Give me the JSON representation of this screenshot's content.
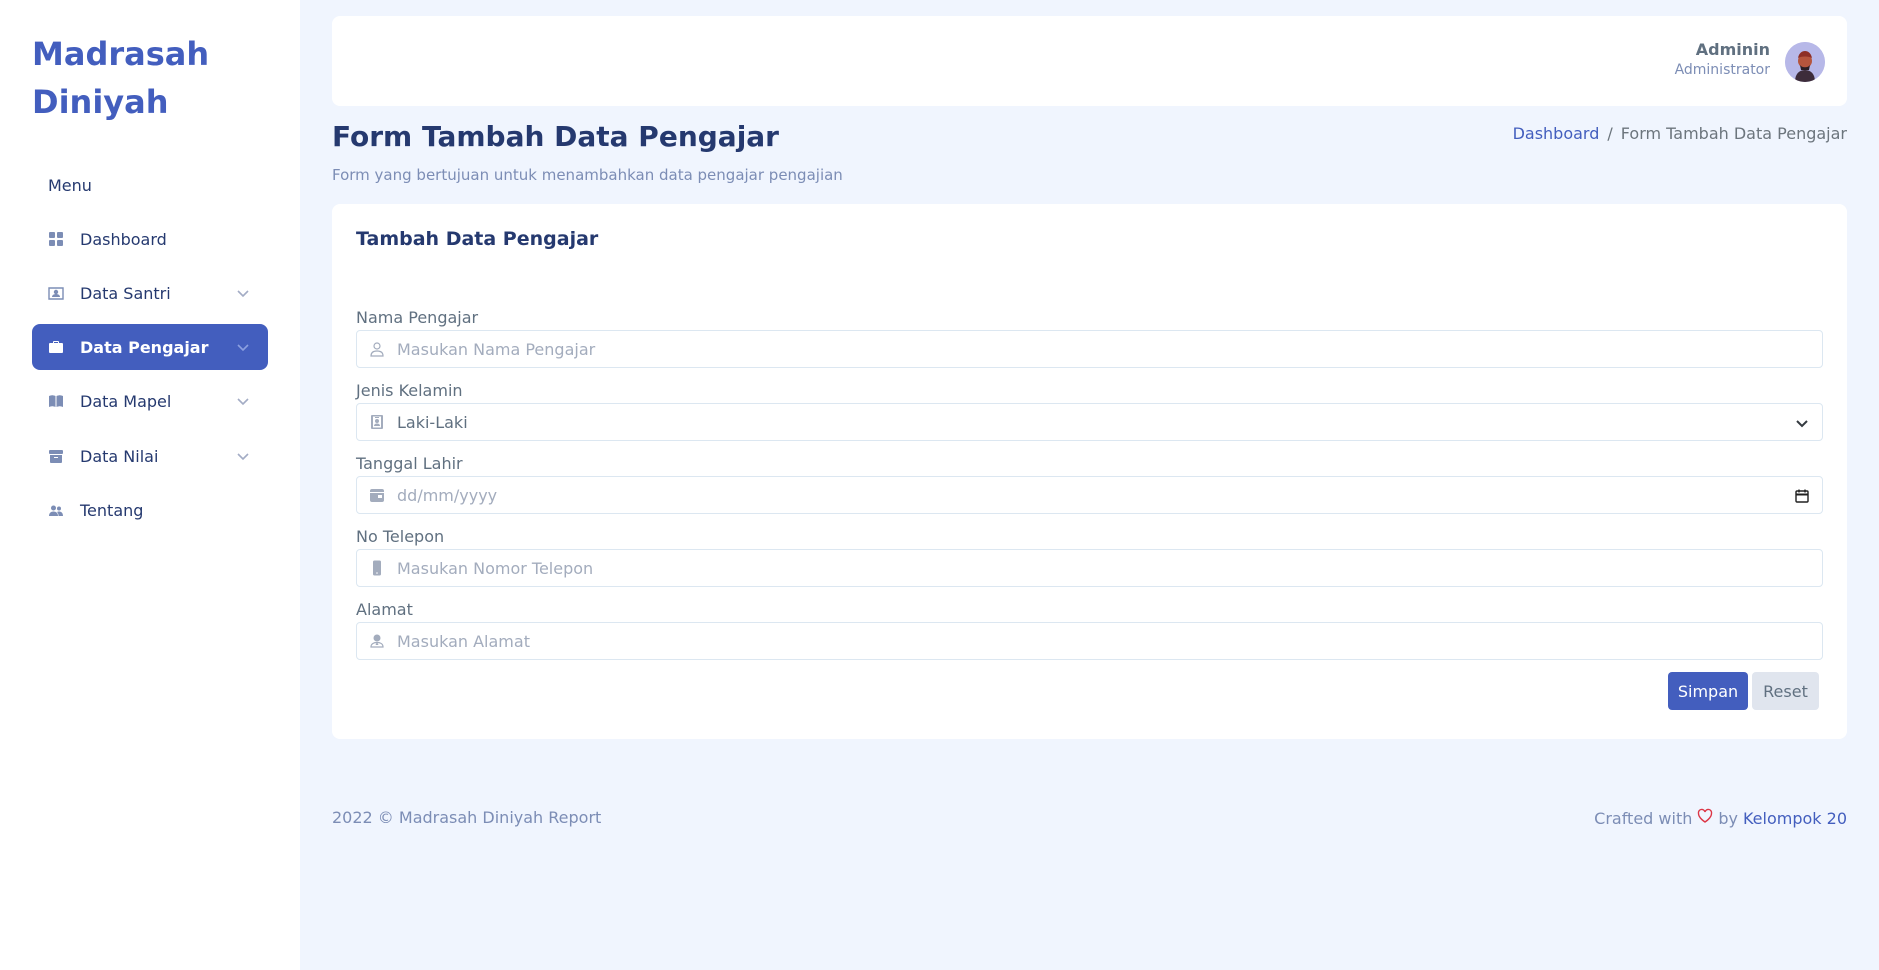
{
  "sidebar": {
    "brand": "Madrasah Diniyah",
    "menu_title": "Menu",
    "items": [
      {
        "label": "Dashboard",
        "icon": "grid-icon"
      },
      {
        "label": "Data Santri",
        "icon": "person-badge-icon"
      },
      {
        "label": "Data Pengajar",
        "icon": "briefcase-icon",
        "active": true
      },
      {
        "label": "Data Mapel",
        "icon": "book-icon"
      },
      {
        "label": "Data Nilai",
        "icon": "archive-icon"
      },
      {
        "label": "Tentang",
        "icon": "people-icon"
      }
    ]
  },
  "header": {
    "user_name": "Adminin",
    "user_role": "Administrator"
  },
  "page": {
    "title": "Form Tambah Data Pengajar",
    "subtitle": "Form yang bertujuan untuk menambahkan data pengajar pengajian",
    "breadcrumb": {
      "home": "Dashboard",
      "separator": "/",
      "current": "Form Tambah Data Pengajar"
    }
  },
  "form": {
    "title": "Tambah Data Pengajar",
    "nama": {
      "label": "Nama Pengajar",
      "placeholder": "Masukan Nama Pengajar"
    },
    "jenis_kelamin": {
      "label": "Jenis Kelamin",
      "value": "Laki-Laki"
    },
    "tanggal_lahir": {
      "label": "Tanggal Lahir",
      "placeholder": "dd/mm/yyyy"
    },
    "telepon": {
      "label": "No Telepon",
      "placeholder": "Masukan Nomor Telepon"
    },
    "alamat": {
      "label": "Alamat",
      "placeholder": "Masukan Alamat"
    },
    "submit_label": "Simpan",
    "reset_label": "Reset"
  },
  "footer": {
    "copyright": "2022 © Madrasah Diniyah Report",
    "crafted": "Crafted with",
    "by": "by",
    "team": "Kelompok 20"
  },
  "colors": {
    "accent": "#435ebe",
    "background": "#f0f5fe",
    "text": "#25396f"
  }
}
